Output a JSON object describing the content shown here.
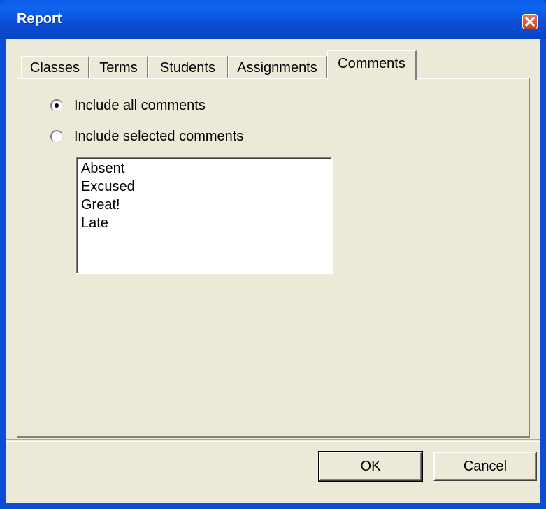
{
  "window": {
    "title": "Report"
  },
  "tabs": [
    {
      "label": "Classes"
    },
    {
      "label": "Terms"
    },
    {
      "label": "Students"
    },
    {
      "label": "Assignments"
    },
    {
      "label": "Comments"
    }
  ],
  "active_tab": "Comments",
  "options": {
    "include_all": {
      "label": "Include all comments",
      "checked": true
    },
    "include_selected": {
      "label": "Include selected comments",
      "checked": false
    }
  },
  "comments_list": [
    "Absent",
    "Excused",
    "Great!",
    "Late"
  ],
  "buttons": {
    "ok": "OK",
    "cancel": "Cancel"
  },
  "colors": {
    "titlebar": "#0a4ed6",
    "dialog_bg": "#ece9d8",
    "close_button": "#c4411c"
  }
}
